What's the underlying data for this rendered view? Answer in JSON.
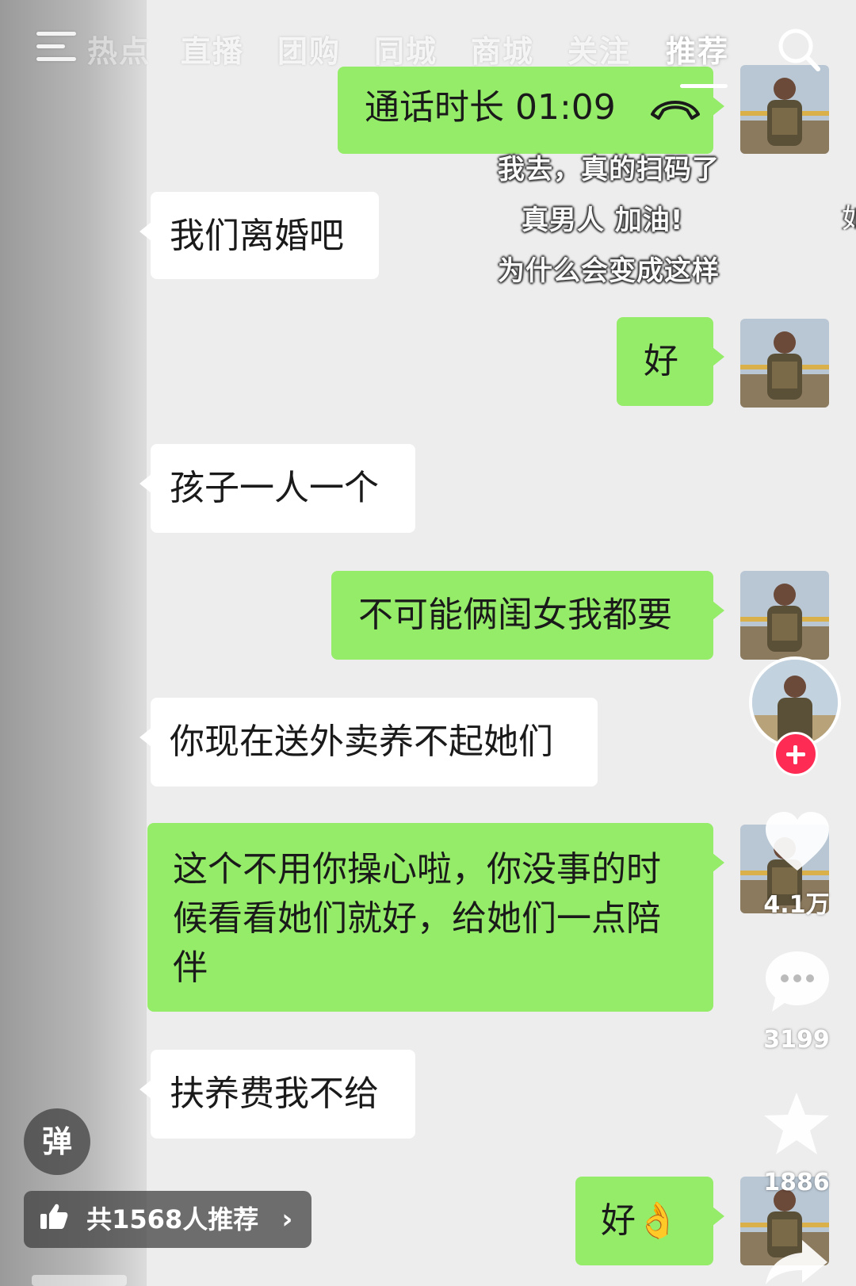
{
  "top_nav": {
    "tabs": [
      {
        "label": "热点"
      },
      {
        "label": "直播"
      },
      {
        "label": "团购"
      },
      {
        "label": "同城"
      },
      {
        "label": "商城"
      },
      {
        "label": "关注"
      },
      {
        "label": "推荐"
      }
    ],
    "active_tab": "推荐",
    "menu_icon": "menu-icon",
    "search_icon": "search-icon"
  },
  "chat": {
    "call_record": {
      "text": "通话时长 01:09",
      "icon": "phone-hangup-icon"
    },
    "messages": [
      {
        "side": "incoming",
        "text": "我们离婚吧"
      },
      {
        "side": "outgoing",
        "text": "好"
      },
      {
        "side": "incoming",
        "text": "孩子一人一个"
      },
      {
        "side": "outgoing",
        "text": "不可能俩闺女我都要"
      },
      {
        "side": "incoming",
        "text": "你现在送外卖养不起她们"
      },
      {
        "side": "outgoing",
        "text": "这个不用你操心啦，你没事的时候看看她们就好，给她们一点陪伴"
      },
      {
        "side": "incoming",
        "text": "扶养费我不给"
      },
      {
        "side": "outgoing",
        "text": "好👌"
      }
    ]
  },
  "danmaku": [
    {
      "text": "我去，真的扫码了"
    },
    {
      "text": "真男人 加油!"
    },
    {
      "text": "为什么会变成这样"
    },
    {
      "text": "如"
    }
  ],
  "right_rail": {
    "like_count": "4.1万",
    "comment_count": "3199",
    "favorite_count": "1886",
    "icons": [
      "heart-icon",
      "comment-icon",
      "star-icon",
      "share-icon"
    ]
  },
  "bottom": {
    "danmaku_toggle_label": "弹",
    "recommend_label": "共1568人推荐",
    "chevron": "›"
  },
  "colors": {
    "outgoing_bubble": "#95ec69",
    "incoming_bubble": "#ffffff",
    "follow_button": "#fe2c55",
    "chat_background": "#ededed"
  }
}
